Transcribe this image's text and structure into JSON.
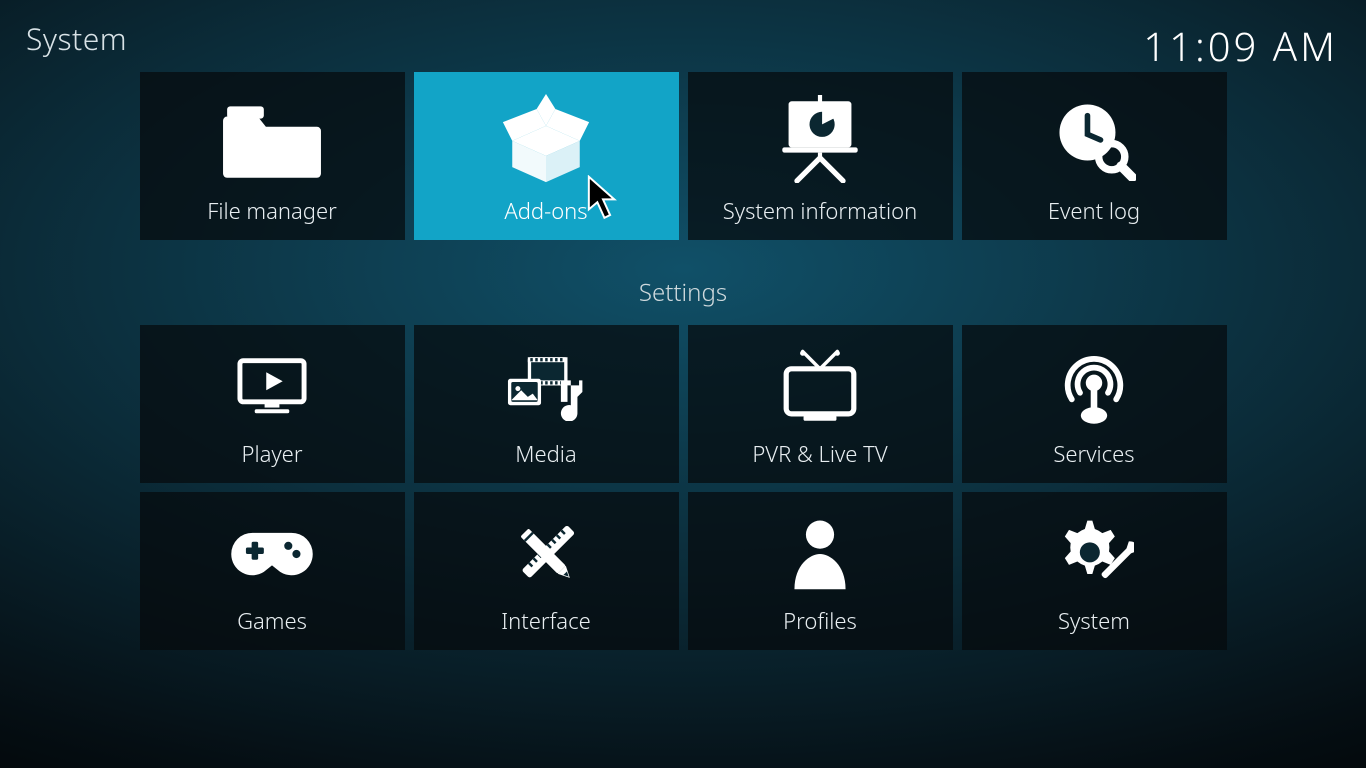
{
  "header": {
    "title": "System",
    "clock": "11:09 AM"
  },
  "section_label": "Settings",
  "top_row": [
    {
      "id": "file-manager",
      "label": "File manager",
      "icon": "folder-icon",
      "selected": false
    },
    {
      "id": "add-ons",
      "label": "Add-ons",
      "icon": "open-box-icon",
      "selected": true
    },
    {
      "id": "system-information",
      "label": "System information",
      "icon": "easel-chart-icon",
      "selected": false
    },
    {
      "id": "event-log",
      "label": "Event log",
      "icon": "clock-search-icon",
      "selected": false
    }
  ],
  "settings_rows": [
    [
      {
        "id": "player",
        "label": "Player",
        "icon": "monitor-play-icon"
      },
      {
        "id": "media",
        "label": "Media",
        "icon": "media-collage-icon"
      },
      {
        "id": "pvr-live-tv",
        "label": "PVR & Live TV",
        "icon": "tv-antenna-icon"
      },
      {
        "id": "services",
        "label": "Services",
        "icon": "broadcast-icon"
      }
    ],
    [
      {
        "id": "games",
        "label": "Games",
        "icon": "gamepad-icon"
      },
      {
        "id": "interface",
        "label": "Interface",
        "icon": "ruler-pencil-icon"
      },
      {
        "id": "profiles",
        "label": "Profiles",
        "icon": "person-icon"
      },
      {
        "id": "system",
        "label": "System",
        "icon": "gear-wrench-icon"
      }
    ]
  ],
  "colors": {
    "tile_bg": "rgba(5,10,12,0.72)",
    "tile_selected": "#12a4c7",
    "fg": "#ffffff"
  }
}
